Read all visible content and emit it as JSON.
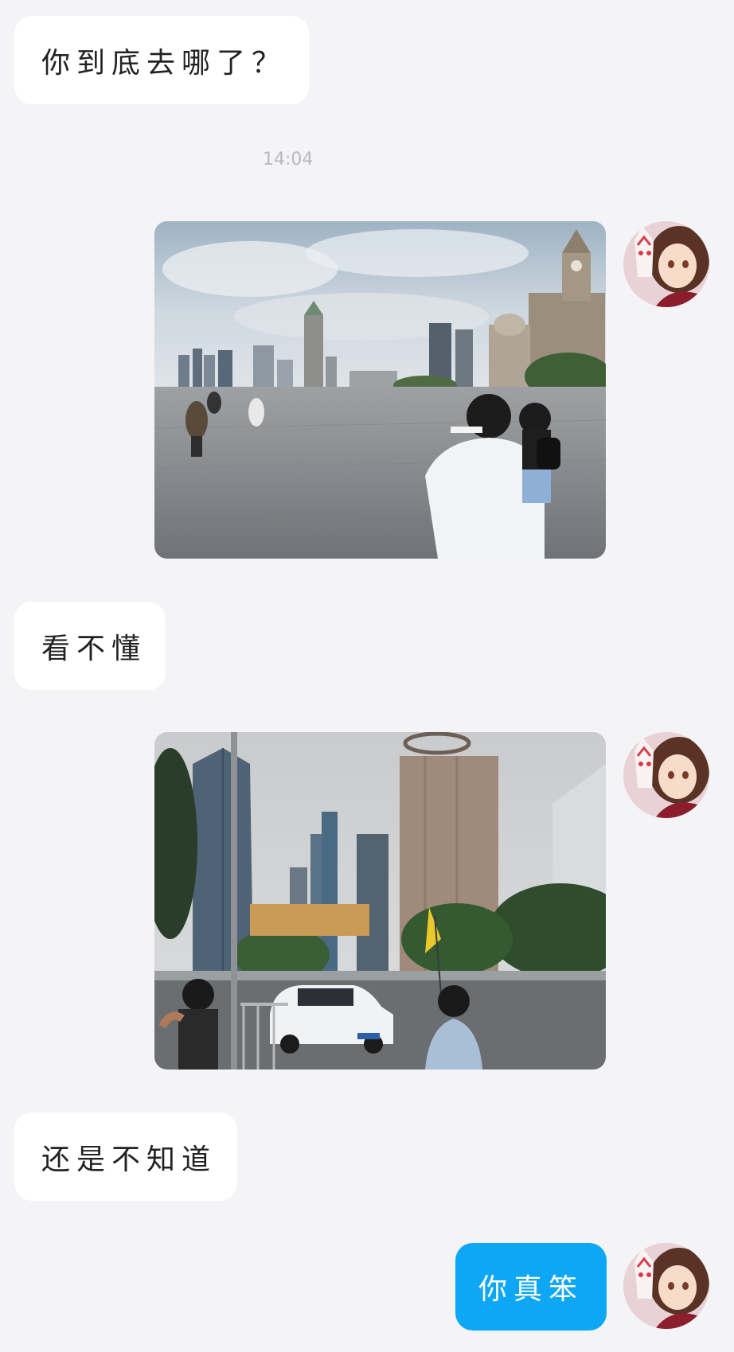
{
  "messages": {
    "m1": {
      "text": "你到底去哪了？"
    },
    "timestamp": "14:04",
    "m2": {
      "image": "photo of riverside promenade with historic buildings"
    },
    "m3": {
      "text": "看不懂"
    },
    "m4": {
      "image": "photo of city street with skyscrapers and white car"
    },
    "m5": {
      "text": "还是不知道"
    },
    "m6": {
      "text": "你真笨"
    }
  },
  "colors": {
    "background": "#f4f4f6",
    "incoming_bubble": "#ffffff",
    "outgoing_bubble": "#0da7f5",
    "timestamp_text": "#b9b9bc"
  },
  "icons": {
    "avatar": "anime-girl-fox-mask-avatar"
  }
}
